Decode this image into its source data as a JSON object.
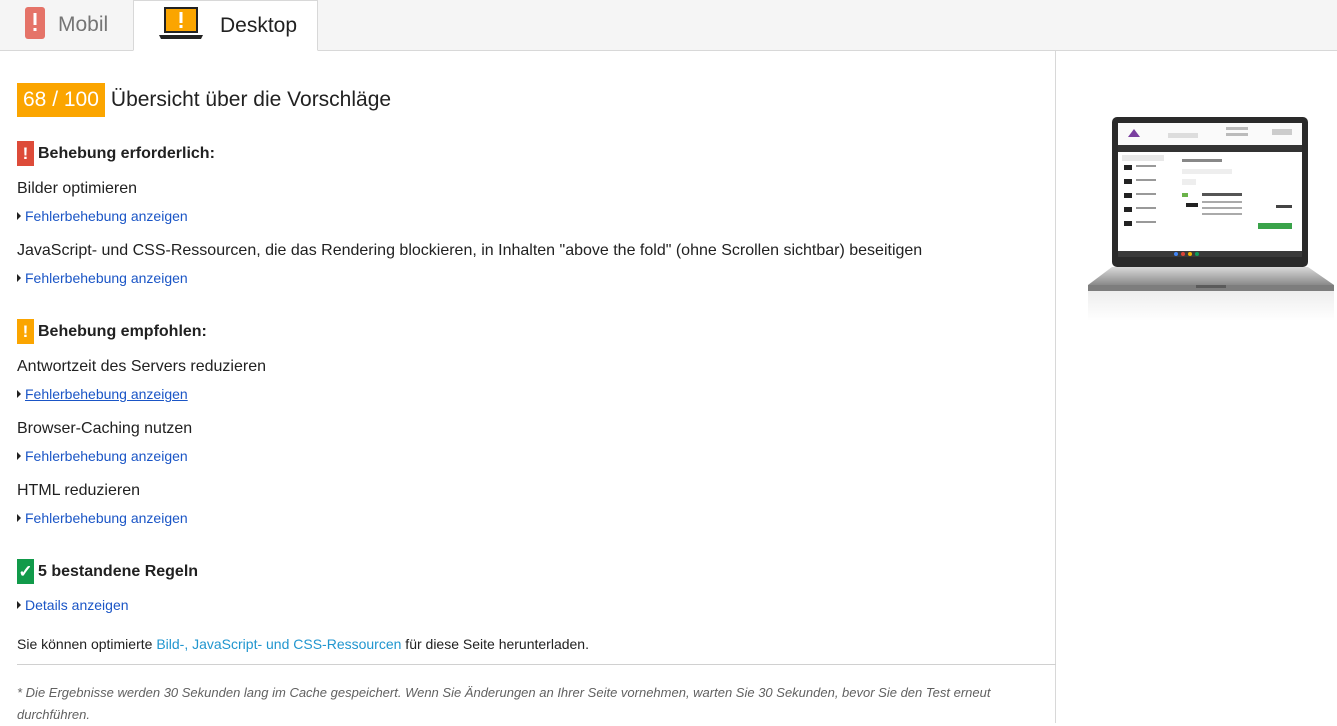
{
  "tabs": {
    "mobile": {
      "label": "Mobil",
      "icon": "mobile-warning-icon"
    },
    "desktop": {
      "label": "Desktop",
      "icon": "desktop-warning-icon"
    }
  },
  "score": {
    "value": "68 / 100",
    "title": "Übersicht über die Vorschläge",
    "color": "#fba500"
  },
  "sections": {
    "required": {
      "icon_glyph": "!",
      "title": "Behebung erforderlich:",
      "color": "#dd4b39",
      "rules": [
        {
          "title": "Bilder optimieren",
          "link": "Fehlerbehebung anzeigen"
        },
        {
          "title": "JavaScript- und CSS-Ressourcen, die das Rendering blockieren, in Inhalten \"above the fold\" (ohne Scrollen sichtbar) beseitigen",
          "link": "Fehlerbehebung anzeigen"
        }
      ]
    },
    "recommended": {
      "icon_glyph": "!",
      "title": "Behebung empfohlen:",
      "color": "#fba500",
      "rules": [
        {
          "title": "Antwortzeit des Servers reduzieren",
          "link": "Fehlerbehebung anzeigen"
        },
        {
          "title": "Browser-Caching nutzen",
          "link": "Fehlerbehebung anzeigen"
        },
        {
          "title": "HTML reduzieren",
          "link": "Fehlerbehebung anzeigen"
        }
      ]
    },
    "passed": {
      "icon_glyph": "✓",
      "title": "5 bestandene Regeln",
      "color": "#119a4a",
      "link": "Details anzeigen"
    }
  },
  "download": {
    "prefix": "Sie können optimierte ",
    "link": "Bild-, JavaScript- und CSS-Ressourcen",
    "suffix": " für diese Seite herunterladen."
  },
  "footnote": "* Die Ergebnisse werden 30 Sekunden lang im Cache gespeichert. Wenn Sie Änderungen an Ihrer Seite vornehmen, warten Sie 30 Sekunden, bevor Sie den Test erneut durchführen.",
  "preview": {
    "icon": "laptop-screenshot-preview"
  },
  "colors": {
    "link": "#1a55c6",
    "inline_link": "#2196cf"
  }
}
